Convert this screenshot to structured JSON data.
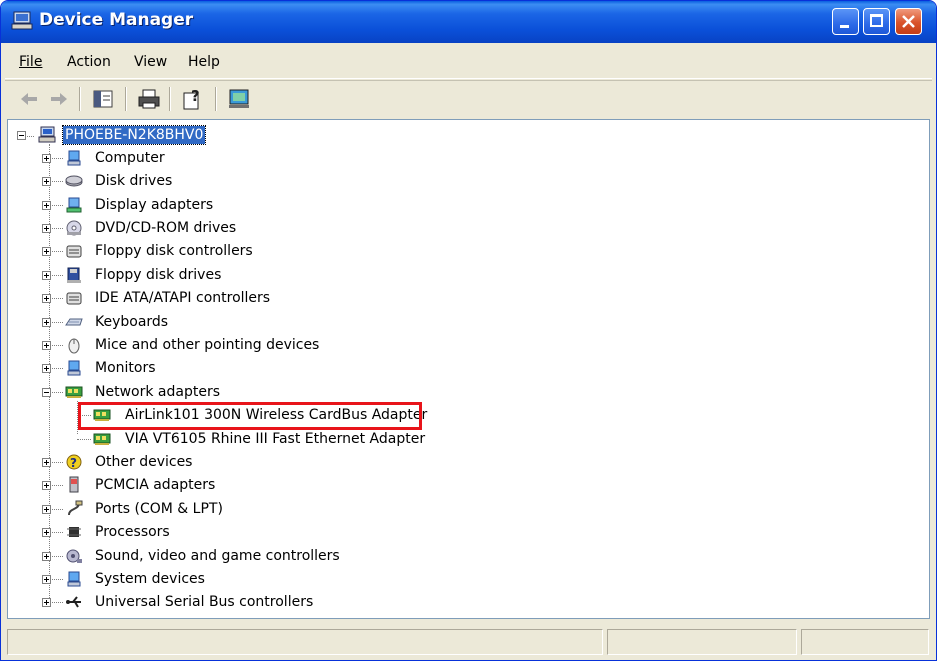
{
  "window": {
    "title": "Device Manager"
  },
  "titlebar_buttons": [
    "minimize-icon",
    "maximize-icon",
    "close-icon"
  ],
  "menu": [
    {
      "label": "File",
      "underline": "F"
    },
    {
      "label": "Action",
      "underline": "A"
    },
    {
      "label": "View",
      "underline": "V"
    },
    {
      "label": "Help",
      "underline": "H"
    }
  ],
  "toolbar": {
    "icons": [
      "back-icon",
      "forward-icon",
      "show-hide-console-tree-icon",
      "print-icon",
      "properties-help-icon",
      "scan-hardware-icon"
    ]
  },
  "tree": {
    "root": {
      "label": "PHOEBE-N2K8BHV0",
      "icon": "computer-icon",
      "expanded": true,
      "selected": true
    },
    "items": [
      {
        "label": "Computer",
        "icon": "computer-monitor-icon",
        "expanded": false
      },
      {
        "label": "Disk drives",
        "icon": "disk-drive-icon",
        "expanded": false
      },
      {
        "label": "Display adapters",
        "icon": "display-adapter-icon",
        "expanded": false
      },
      {
        "label": "DVD/CD-ROM drives",
        "icon": "cd-rom-icon",
        "expanded": false
      },
      {
        "label": "Floppy disk controllers",
        "icon": "floppy-controller-icon",
        "expanded": false
      },
      {
        "label": "Floppy disk drives",
        "icon": "floppy-drive-icon",
        "expanded": false
      },
      {
        "label": "IDE ATA/ATAPI controllers",
        "icon": "ide-controller-icon",
        "expanded": false
      },
      {
        "label": "Keyboards",
        "icon": "keyboard-icon",
        "expanded": false
      },
      {
        "label": "Mice and other pointing devices",
        "icon": "mouse-icon",
        "expanded": false
      },
      {
        "label": "Monitors",
        "icon": "monitor-icon",
        "expanded": false
      },
      {
        "label": "Network adapters",
        "icon": "network-adapter-icon",
        "expanded": true,
        "children": [
          {
            "label": "AirLink101 300N Wireless CardBus Adapter",
            "icon": "network-adapter-icon",
            "highlighted": true
          },
          {
            "label": "VIA VT6105 Rhine III Fast Ethernet Adapter",
            "icon": "network-adapter-icon",
            "highlighted": false
          }
        ]
      },
      {
        "label": "Other devices",
        "icon": "question-mark-icon",
        "expanded": false
      },
      {
        "label": "PCMCIA adapters",
        "icon": "pcmcia-icon",
        "expanded": false
      },
      {
        "label": "Ports (COM & LPT)",
        "icon": "port-icon",
        "expanded": false
      },
      {
        "label": "Processors",
        "icon": "processor-icon",
        "expanded": false
      },
      {
        "label": "Sound, video and game controllers",
        "icon": "sound-icon",
        "expanded": false
      },
      {
        "label": "System devices",
        "icon": "system-devices-icon",
        "expanded": false
      },
      {
        "label": "Universal Serial Bus controllers",
        "icon": "usb-icon",
        "expanded": false
      }
    ]
  },
  "colors": {
    "titlebar": "#0a4fd8",
    "selection": "#316ac5",
    "highlight_box": "#e8141a",
    "window_face": "#ece9d8"
  }
}
